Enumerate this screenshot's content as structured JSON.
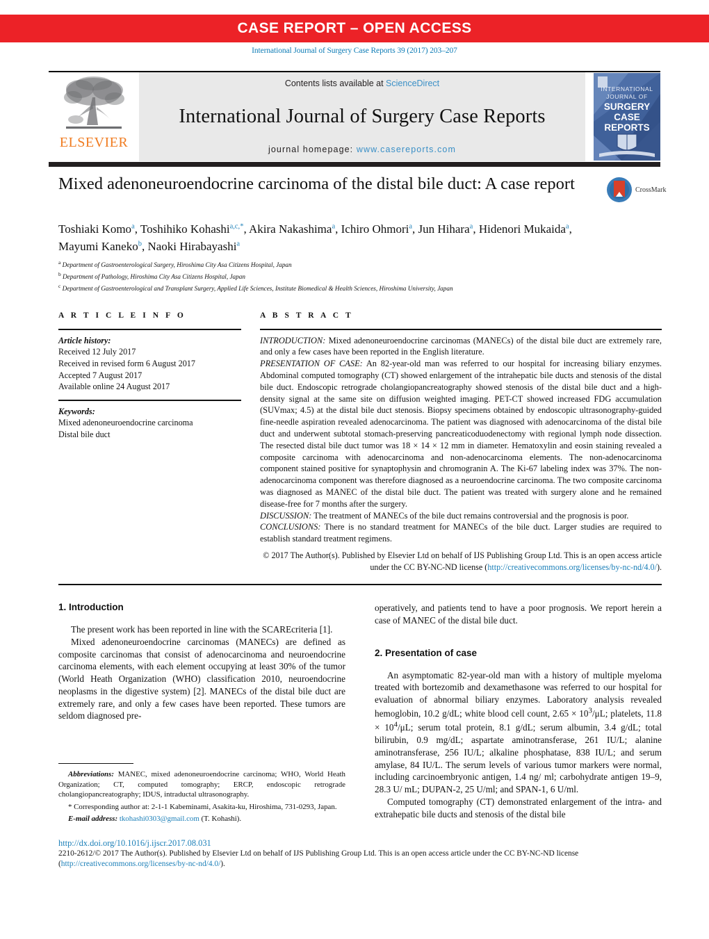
{
  "banner": {
    "label": "CASE REPORT – OPEN ACCESS",
    "background_color": "#ec2227",
    "text_color": "#ffffff"
  },
  "citation": "International Journal of Surgery Case Reports 39 (2017) 203–207",
  "masthead": {
    "publisher_name": "ELSEVIER",
    "contents_prefix": "Contents lists available at ",
    "contents_link": "ScienceDirect",
    "journal_title": "International Journal of Surgery Case Reports",
    "homepage_prefix": "journal homepage: ",
    "homepage_link": "www.casereports.com",
    "cover_lines": [
      "INTERNATIONAL",
      "JOURNAL OF",
      "SURGERY",
      "CASE",
      "REPORTS"
    ],
    "link_color": "#3a8fc6"
  },
  "article": {
    "title": "Mixed adenoneuroendocrine carcinoma of the distal bile duct: A case report",
    "crossmark_label": "CrossMark",
    "authors_html": "Toshiaki Komo<sup>a</sup>, Toshihiko Kohashi<sup>a,c,<span class=\"corr\">*</span></sup>, Akira Nakashima<sup>a</sup>, Ichiro Ohmori<sup>a</sup>, Jun Hihara<sup>a</sup>, Hidenori Mukaida<sup>a</sup>, Mayumi Kaneko<sup>b</sup>, Naoki Hirabayashi<sup>a</sup>",
    "affiliations": [
      {
        "mark": "a",
        "text": "Department of Gastroenterological Surgery, Hiroshima City Asa Citizens Hospital, Japan"
      },
      {
        "mark": "b",
        "text": "Department of Pathology, Hiroshima City Asa Citizens Hospital, Japan"
      },
      {
        "mark": "c",
        "text": "Department of Gastroenterological and Transplant Surgery, Applied Life Sciences, Institute Biomedical & Health Sciences, Hiroshima University, Japan"
      }
    ]
  },
  "article_info": {
    "heading": "A R T I C L E   I N F O",
    "history_label": "Article history:",
    "history": [
      "Received 12 July 2017",
      "Received in revised form 6 August 2017",
      "Accepted 7 August 2017",
      "Available online 24 August 2017"
    ],
    "keywords_label": "Keywords:",
    "keywords": [
      "Mixed adenoneuroendocrine carcinoma",
      "Distal bile duct"
    ]
  },
  "abstract": {
    "heading": "A B S T R A C T",
    "sections": [
      {
        "lead": "INTRODUCTION:",
        "text": " Mixed adenoneuroendocrine carcinomas (MANECs) of the distal bile duct are extremely rare, and only a few cases have been reported in the English literature."
      },
      {
        "lead": "PRESENTATION OF CASE:",
        "text": " An 82-year-old man was referred to our hospital for increasing biliary enzymes. Abdominal computed tomography (CT) showed enlargement of the intrahepatic bile ducts and stenosis of the distal bile duct. Endoscopic retrograde cholangiopancreatography showed stenosis of the distal bile duct and a high-density signal at the same site on diffusion weighted imaging. PET-CT showed increased FDG accumulation (SUVmax; 4.5) at the distal bile duct stenosis. Biopsy specimens obtained by endoscopic ultrasonography-guided fine-needle aspiration revealed adenocarcinoma. The patient was diagnosed with adenocarcinoma of the distal bile duct and underwent subtotal stomach-preserving pancreaticoduodenectomy with regional lymph node dissection. The resected distal bile duct tumor was 18 × 14 × 12 mm in diameter. Hematoxylin and eosin staining revealed a composite carcinoma with adenocarcinoma and non-adenocarcinoma elements. The non-adenocarcinoma component stained positive for synaptophysin and chromogranin A. The Ki-67 labeling index was 37%. The non-adenocarcinoma component was therefore diagnosed as a neuroendocrine carcinoma. The two composite carcinoma was diagnosed as MANEC of the distal bile duct. The patient was treated with surgery alone and he remained disease-free for 7 months after the surgery."
      },
      {
        "lead": "DISCUSSION:",
        "text": " The treatment of MANECs of the bile duct remains controversial and the prognosis is poor."
      },
      {
        "lead": "CONCLUSIONS:",
        "text": " There is no standard treatment for MANECs of the bile duct. Larger studies are required to establish standard treatment regimens."
      }
    ],
    "copyright_text": "© 2017 The Author(s). Published by Elsevier Ltd on behalf of IJS Publishing Group Ltd. This is an open access article under the CC BY-NC-ND license (",
    "copyright_link": "http://creativecommons.org/licenses/by-nc-nd/4.0/",
    "copyright_tail": ")."
  },
  "body": {
    "left_column": {
      "section1_title": "1.  Introduction",
      "paragraphs": [
        "The present work has been reported in line with the SCAREcriteria [1].",
        "Mixed adenoneuroendocrine carcinomas (MANECs) are defined as composite carcinomas that consist of adenocarcinoma and neuroendocrine carcinoma elements, with each element occupying at least 30% of the tumor (World Heath Organization (WHO) classification 2010, neuroendocrine neoplasms in the digestive system) [2]. MANECs of the distal bile duct are extremely rare, and only a few cases have been reported. These tumors are seldom diagnosed pre-"
      ],
      "ref1": "[1]",
      "ref2": "[2]"
    },
    "right_column": {
      "continued_paragraph": "operatively, and patients tend to have a poor prognosis. We report herein a case of MANEC of the distal bile duct.",
      "section2_title": "2.  Presentation of case",
      "paragraphs": [
        "An asymptomatic 82-year-old man with a history of multiple myeloma treated with bortezomib and dexamethasone was referred to our hospital for evaluation of abnormal biliary enzymes. Laboratory analysis revealed hemoglobin, 10.2 g/dL; white blood cell count, 2.65 × 10<sup>3</sup>/μL; platelets, 11.8 × 10<sup>4</sup>/μL; serum total protein, 8.1 g/dL; serum albumin, 3.4 g/dL; total bilirubin, 0.9 mg/dL; aspartate aminotransferase, 261 IU/L; alanine aminotransferase, 256 IU/L; alkaline phosphatase, 838 IU/L; and serum amylase, 84 IU/L. The serum levels of various tumor markers were normal, including carcinoembryonic antigen, 1.4 ng/ ml; carbohydrate antigen 19–9, 28.3 U/ mL; DUPAN-2, 25 U/ml; and SPAN-1, 6 U/ml.",
        "Computed tomography (CT) demonstrated enlargement of the intra- and extrahepatic bile ducts and stenosis of the distal bile"
      ]
    }
  },
  "footnotes": {
    "abbrev_label": "Abbreviations:",
    "abbrev_text": "  MANEC, mixed adenoneuroendocrine carcinoma; WHO, World Heath Organization; CT, computed tomography; ERCP, endoscopic retrograde cholangiopancreatography; IDUS, intraductal ultrasonography.",
    "corresponding": "* Corresponding author at: 2-1-1 Kabeminami, Asakita-ku, Hiroshima, 731-0293, Japan.",
    "email_label": "E-mail address:",
    "email": "tkohashi0303@gmail.com",
    "email_tail": " (T. Kohashi)."
  },
  "bottom": {
    "doi": "http://dx.doi.org/10.1016/j.ijscr.2017.08.031",
    "issn_text": "2210-2612/© 2017 The Author(s). Published by Elsevier Ltd on behalf of IJS Publishing Group Ltd. This is an open access article under the CC BY-NC-ND license (",
    "issn_link": "http://creativecommons.org/licenses/by-nc-nd/4.0/",
    "issn_tail": ")."
  }
}
